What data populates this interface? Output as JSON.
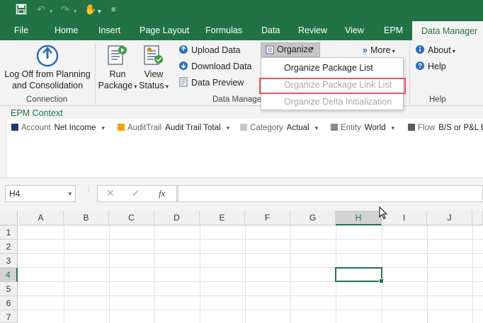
{
  "qat": {
    "save_icon": "save-icon",
    "undo_icon": "undo-icon",
    "redo_icon": "redo-icon",
    "touch_icon": "touch-mode-icon",
    "customize_icon": "customize-icon"
  },
  "tabs": [
    {
      "label": "File"
    },
    {
      "label": "Home"
    },
    {
      "label": "Insert"
    },
    {
      "label": "Page Layout"
    },
    {
      "label": "Formulas"
    },
    {
      "label": "Data"
    },
    {
      "label": "Review"
    },
    {
      "label": "View"
    },
    {
      "label": "EPM"
    },
    {
      "label": "Data Manager",
      "active": true
    }
  ],
  "ribbon": {
    "connection": {
      "logoff_line1": "Log Off from Planning",
      "logoff_line2": "and Consolidation",
      "group_label": "Connection"
    },
    "run_package": {
      "line1": "Run",
      "line2": "Package"
    },
    "view_status": {
      "line1": "View",
      "line2": "Status"
    },
    "upload_data": "Upload Data",
    "download_data": "Download Data",
    "data_preview": "Data Preview",
    "data_manager_group": "Data Manage",
    "organize": "Organize",
    "more": "More",
    "about": "About",
    "help": "Help",
    "help_group": "Help"
  },
  "organize_menu": [
    {
      "label": "Organize Package List",
      "enabled": true
    },
    {
      "label": "Organize Package Link List",
      "enabled": false
    },
    {
      "label": "Organize Delta Initialization",
      "enabled": false
    }
  ],
  "epm_context": {
    "title": "EPM Context",
    "items": [
      {
        "key": "Account",
        "value": "Net Income",
        "color": "#1f3a7a"
      },
      {
        "key": "AuditTrail",
        "value": "Audit Trail Total",
        "color": "#f0a30a"
      },
      {
        "key": "Category",
        "value": "Actual",
        "color": "#c8c8c8"
      },
      {
        "key": "Entity",
        "value": "World",
        "color": "#8a8a8a"
      },
      {
        "key": "Flow",
        "value": "B/S or P&L ba",
        "color": "#5a5a5a"
      }
    ]
  },
  "formula_bar": {
    "name_box": "H4",
    "cancel_icon": "cancel-icon",
    "enter_icon": "enter-icon",
    "fx": "fx",
    "formula": ""
  },
  "grid": {
    "columns": [
      "A",
      "B",
      "C",
      "D",
      "E",
      "F",
      "G",
      "H",
      "I",
      "J"
    ],
    "rows": [
      "1",
      "2",
      "3",
      "4",
      "5",
      "6",
      "7"
    ],
    "selected_cell": "H4"
  }
}
